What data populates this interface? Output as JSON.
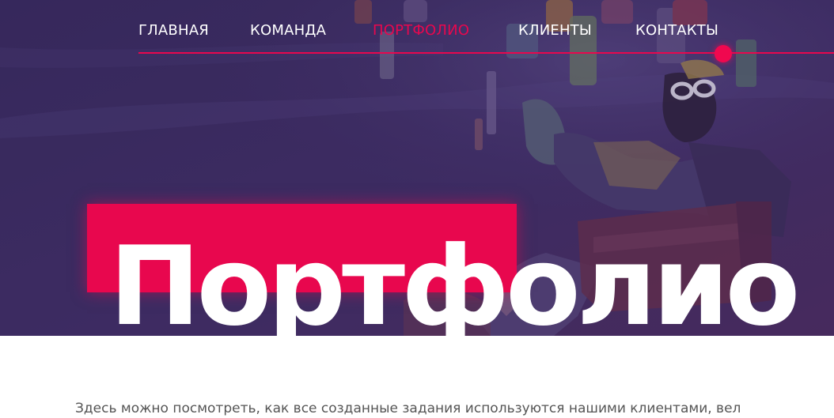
{
  "nav": {
    "items": [
      {
        "label": "ГЛАВНАЯ",
        "active": false
      },
      {
        "label": "КОМАНДА",
        "active": false
      },
      {
        "label": "ПОРТФОЛИО",
        "active": true
      },
      {
        "label": "КЛИЕНТЫ",
        "active": false
      },
      {
        "label": "КОНТАКТЫ",
        "active": false
      }
    ]
  },
  "hero": {
    "title": "Портфолио",
    "background_image": "underwater-photo-person-in-armchair"
  },
  "intro": {
    "text": "Здесь можно посмотреть, как все созданные задания используются нашими клиентами, вел"
  },
  "colors": {
    "accent": "#e8074e",
    "hero_overlay": "#3b2a60",
    "nav_text": "#ffffff",
    "body_text": "#555555"
  }
}
